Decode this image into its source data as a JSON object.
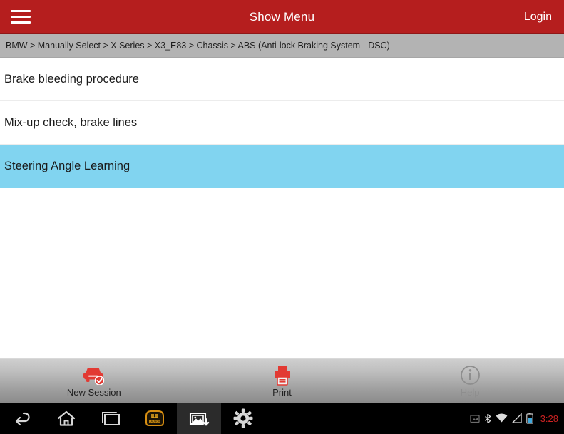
{
  "header": {
    "menu_icon": "hamburger-icon",
    "title": "Show Menu",
    "login_label": "Login",
    "background_color": "#b51e1e"
  },
  "breadcrumb": {
    "text": "BMW > Manually Select > X Series > X3_E83 > Chassis > ABS (Anti-lock Braking System - DSC)",
    "background_color": "#b3b3b3"
  },
  "menu": {
    "selected_color": "#81d4f0",
    "items": [
      {
        "label": "Brake bleeding procedure",
        "selected": false
      },
      {
        "label": "Mix-up check, brake lines",
        "selected": false
      },
      {
        "label": "Steering Angle Learning",
        "selected": true
      }
    ]
  },
  "toolbar": {
    "buttons": [
      {
        "label": "New Session",
        "icon": "car-check-icon",
        "color": "#e23a33",
        "disabled": false
      },
      {
        "label": "Print",
        "icon": "printer-icon",
        "color": "#e23a33",
        "disabled": false
      },
      {
        "label": "Help",
        "icon": "info-circle-icon",
        "color": "#8e8e8e",
        "disabled": true
      }
    ]
  },
  "navbar": {
    "buttons": [
      {
        "icon": "back-arrow-icon",
        "active": false
      },
      {
        "icon": "home-icon",
        "active": false
      },
      {
        "icon": "recents-icon",
        "active": false
      },
      {
        "icon": "launch-logo-icon",
        "active": false
      },
      {
        "icon": "screenshot-icon",
        "active": true
      },
      {
        "icon": "gear-icon",
        "active": false
      }
    ],
    "status": {
      "icons": [
        "sd-card-icon",
        "bluetooth-icon",
        "wifi-icon",
        "signal-icon",
        "battery-icon"
      ],
      "time": "3:28",
      "time_color": "#cc2222"
    }
  }
}
